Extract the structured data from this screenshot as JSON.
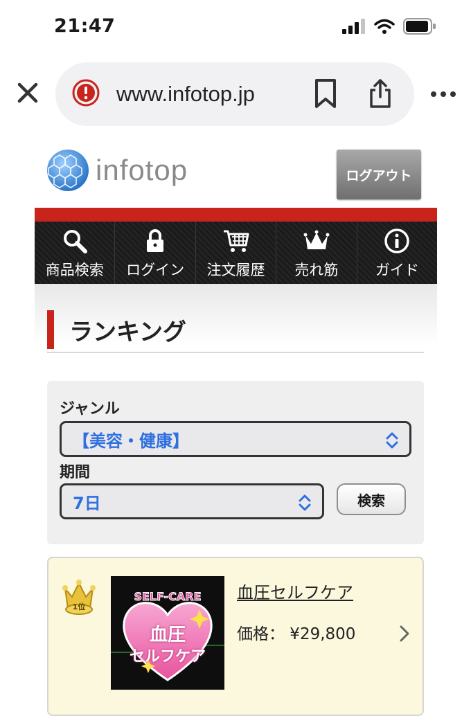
{
  "status_bar": {
    "time": "21:47",
    "icons": [
      "signal-icon",
      "wifi-icon",
      "battery-icon"
    ]
  },
  "browser": {
    "url": "www.infotop.jp",
    "icons": [
      "close-icon",
      "alert-icon",
      "bookmark-icon",
      "share-icon",
      "more-icon"
    ]
  },
  "header": {
    "logo_text": "infotop",
    "logout_label": "ログアウト"
  },
  "nav": {
    "items": [
      {
        "label": "商品検索",
        "icon": "search-icon"
      },
      {
        "label": "ログイン",
        "icon": "lock-icon"
      },
      {
        "label": "注文履歴",
        "icon": "cart-icon"
      },
      {
        "label": "売れ筋",
        "icon": "crown-icon"
      },
      {
        "label": "ガイド",
        "icon": "info-icon"
      }
    ]
  },
  "page": {
    "title": "ランキング"
  },
  "filters": {
    "genre_label": "ジャンル",
    "genre_value": "【美容・健康】",
    "period_label": "期間",
    "period_value": "7日",
    "search_label": "検索"
  },
  "ranking": {
    "items": [
      {
        "rank_badge": "1位",
        "title": "血圧セルフケア",
        "price": "価格： ¥29,800",
        "thumb_caption_en": "SELF-CARE",
        "thumb_caption_1": "血圧",
        "thumb_caption_2": "セルフケア"
      }
    ]
  },
  "colors": {
    "accent_red": "#c8241b",
    "link_blue": "#2f6fe0",
    "card_bg": "#fbf8dd",
    "nav_bg": "#1d1d1d"
  }
}
